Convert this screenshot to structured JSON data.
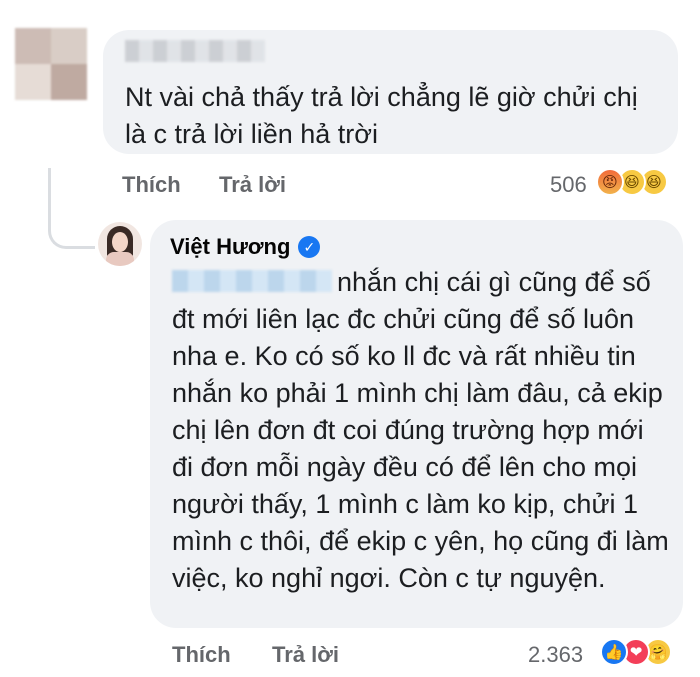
{
  "comment1": {
    "text": "Nt vài chả thấy trả lời chẳng lẽ giờ chửi chị là c trả lời liền hả trời",
    "actions": {
      "like": "Thích",
      "reply": "Trả lời"
    },
    "reaction_count": "506",
    "reactions": [
      "angry",
      "haha",
      "haha"
    ]
  },
  "reply1": {
    "author": "Việt Hương",
    "text": "nhắn chị cái gì cũng để số đt mới liên lạc đc chửi cũng để số luôn nha e. Ko có số ko ll đc và rất nhiều tin nhắn ko phải 1 mình chị làm đâu, cả ekip chị lên đơn đt coi đúng trường hợp mới đi đơn mỗi ngày đều có để lên cho mọi người thấy, 1 mình c làm ko kịp, chửi 1 mình c thôi, để ekip c yên, họ cũng đi làm việc, ko nghỉ ngơi. Còn c tự nguyện.",
    "actions": {
      "like": "Thích",
      "reply": "Trả lời"
    },
    "reaction_count": "2.363",
    "reactions": [
      "like",
      "love",
      "care"
    ]
  },
  "colors": {
    "bubble": "#f0f2f5",
    "secondary_text": "#65676b",
    "accent": "#1877f2"
  }
}
